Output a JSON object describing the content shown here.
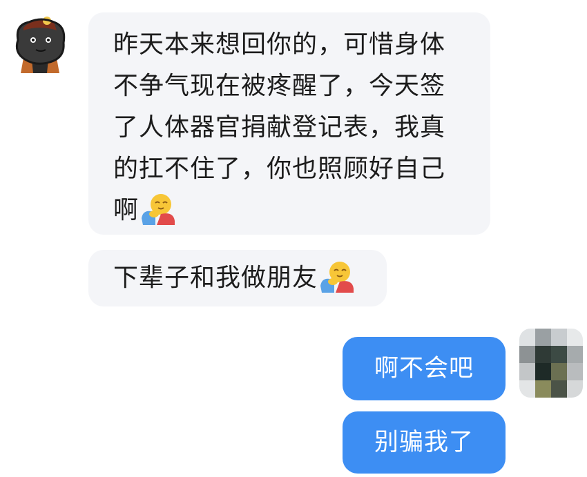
{
  "conversation": {
    "incoming": [
      {
        "lines": [
          "昨天本来想回你的，可惜身体",
          "不争气现在被疼醒了，今天签",
          "了人体器官捐献登记表，我真",
          "的扛不住了，你也照顾好自己",
          "啊"
        ],
        "emoji": "hug-emoji"
      },
      {
        "text": "下辈子和我做朋友",
        "emoji": "hug-emoji"
      }
    ],
    "outgoing": [
      {
        "text": "啊不会吧"
      },
      {
        "text": "别骗我了"
      }
    ]
  },
  "avatars": {
    "left": "cartoon-character-avatar",
    "right": "pixelated-avatar"
  },
  "colors": {
    "incoming_bubble": "#f4f5f8",
    "outgoing_bubble": "#3d8ef3",
    "incoming_text": "#1c1c1c",
    "outgoing_text": "#ffffff"
  }
}
